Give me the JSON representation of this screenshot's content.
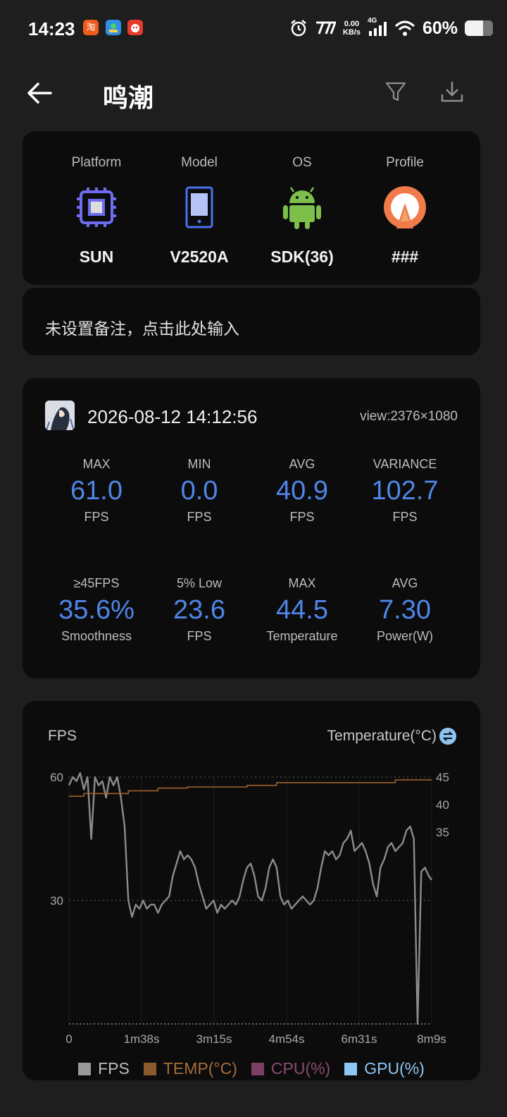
{
  "status_bar": {
    "time": "14:23",
    "net_speed": "0.00",
    "net_unit": "KB/s",
    "signal_type": "4G",
    "battery_percent": "60%",
    "app_icons": [
      "taobao-icon",
      "map-app-icon",
      "news-app-icon"
    ],
    "app_icon_text": [
      "淘",
      "",
      ""
    ]
  },
  "header": {
    "title": "鸣潮",
    "icons": [
      "back-arrow-icon",
      "filter-icon",
      "download-icon"
    ]
  },
  "device": {
    "items": [
      {
        "label": "Platform",
        "value": "SUN",
        "icon": "cpu-chip-icon"
      },
      {
        "label": "Model",
        "value": "V2520A",
        "icon": "phone-icon"
      },
      {
        "label": "OS",
        "value": "SDK(36)",
        "icon": "android-icon"
      },
      {
        "label": "Profile",
        "value": "###",
        "icon": "profile-gauge-icon"
      }
    ]
  },
  "note": {
    "text": "未设置备注，点击此处输入"
  },
  "session": {
    "datetime": "2026-08-12 14:12:56",
    "view": "view:2376×1080",
    "stats": [
      {
        "label": "MAX",
        "value": "61.0",
        "unit": "FPS"
      },
      {
        "label": "MIN",
        "value": "0.0",
        "unit": "FPS"
      },
      {
        "label": "AVG",
        "value": "40.9",
        "unit": "FPS"
      },
      {
        "label": "VARIANCE",
        "value": "102.7",
        "unit": "FPS"
      },
      {
        "label": "≥45FPS",
        "value": "35.6%",
        "unit": "Smoothness"
      },
      {
        "label": "5% Low",
        "value": "23.6",
        "unit": "FPS"
      },
      {
        "label": "MAX",
        "value": "44.5",
        "unit": "Temperature"
      },
      {
        "label": "AVG",
        "value": "7.30",
        "unit": "Power(W)"
      }
    ],
    "value_color": "#4f86e8"
  },
  "chart_data": {
    "type": "line",
    "left_title": "FPS",
    "right_title": "Temperature(°C)",
    "x_ticks": [
      "0",
      "1m38s",
      "3m15s",
      "4m54s",
      "6m31s",
      "8m9s"
    ],
    "y_left_ticks": [
      30,
      60
    ],
    "y_left_range": [
      0,
      60
    ],
    "y_right_ticks": [
      35,
      40,
      45
    ],
    "y_right_range": [
      0,
      45
    ],
    "x_range_seconds": [
      0,
      489
    ],
    "grid": "dotted",
    "legend_position": "bottom-center",
    "series": [
      {
        "name": "FPS",
        "axis": "left",
        "color": "#8c8c8c",
        "x": [
          0,
          5,
          10,
          15,
          20,
          25,
          30,
          35,
          40,
          45,
          50,
          55,
          60,
          65,
          70,
          75,
          80,
          85,
          90,
          95,
          100,
          105,
          110,
          115,
          120,
          125,
          130,
          135,
          140,
          145,
          150,
          155,
          160,
          165,
          170,
          175,
          180,
          185,
          190,
          195,
          200,
          205,
          210,
          215,
          220,
          225,
          230,
          235,
          240,
          245,
          250,
          255,
          260,
          265,
          270,
          275,
          280,
          285,
          290,
          295,
          300,
          305,
          310,
          315,
          320,
          325,
          330,
          335,
          340,
          345,
          350,
          355,
          360,
          365,
          370,
          375,
          380,
          385,
          390,
          395,
          400,
          405,
          410,
          415,
          420,
          425,
          430,
          435,
          440,
          445,
          450,
          455,
          460,
          465,
          470,
          475,
          480,
          485,
          489
        ],
        "y": [
          58,
          60,
          59,
          61,
          57,
          60,
          45,
          60,
          58,
          59,
          55,
          60,
          58,
          60,
          55,
          48,
          30,
          26,
          29,
          28,
          30,
          28,
          29,
          29,
          27,
          29,
          30,
          31,
          36,
          39,
          42,
          40,
          41,
          40,
          38,
          34,
          31,
          28,
          29,
          30,
          27,
          29,
          28,
          29,
          30,
          29,
          31,
          35,
          38,
          39,
          36,
          31,
          30,
          33,
          38,
          40,
          38,
          31,
          29,
          30,
          28,
          29,
          30,
          31,
          30,
          29,
          30,
          33,
          38,
          42,
          41,
          42,
          40,
          41,
          44,
          45,
          47,
          42,
          43,
          44,
          42,
          39,
          34,
          31,
          38,
          40,
          43,
          44,
          42,
          43,
          44,
          47,
          48,
          45,
          0,
          37,
          38,
          36,
          35
        ]
      },
      {
        "name": "TEMP(°C)",
        "axis": "right",
        "color": "#a0622d",
        "x": [
          0,
          20,
          40,
          60,
          80,
          100,
          120,
          140,
          160,
          180,
          200,
          220,
          240,
          260,
          280,
          300,
          320,
          340,
          360,
          380,
          400,
          420,
          440,
          460,
          480,
          489
        ],
        "y": [
          41.5,
          42.0,
          42.0,
          42.0,
          42.5,
          42.5,
          43.0,
          43.0,
          43.2,
          43.2,
          43.2,
          43.2,
          43.5,
          43.5,
          44.0,
          44.0,
          44.0,
          44.0,
          44.0,
          44.0,
          44.0,
          44.0,
          44.5,
          44.5,
          44.5,
          44.5
        ]
      }
    ],
    "legend": [
      {
        "name": "FPS",
        "color": "#9a9a9a"
      },
      {
        "name": "TEMP(°C)",
        "color": "#8b5a2b"
      },
      {
        "name": "CPU(%)",
        "color": "#7a3f63"
      },
      {
        "name": "GPU(%)",
        "color": "#8ec6f4"
      }
    ]
  }
}
